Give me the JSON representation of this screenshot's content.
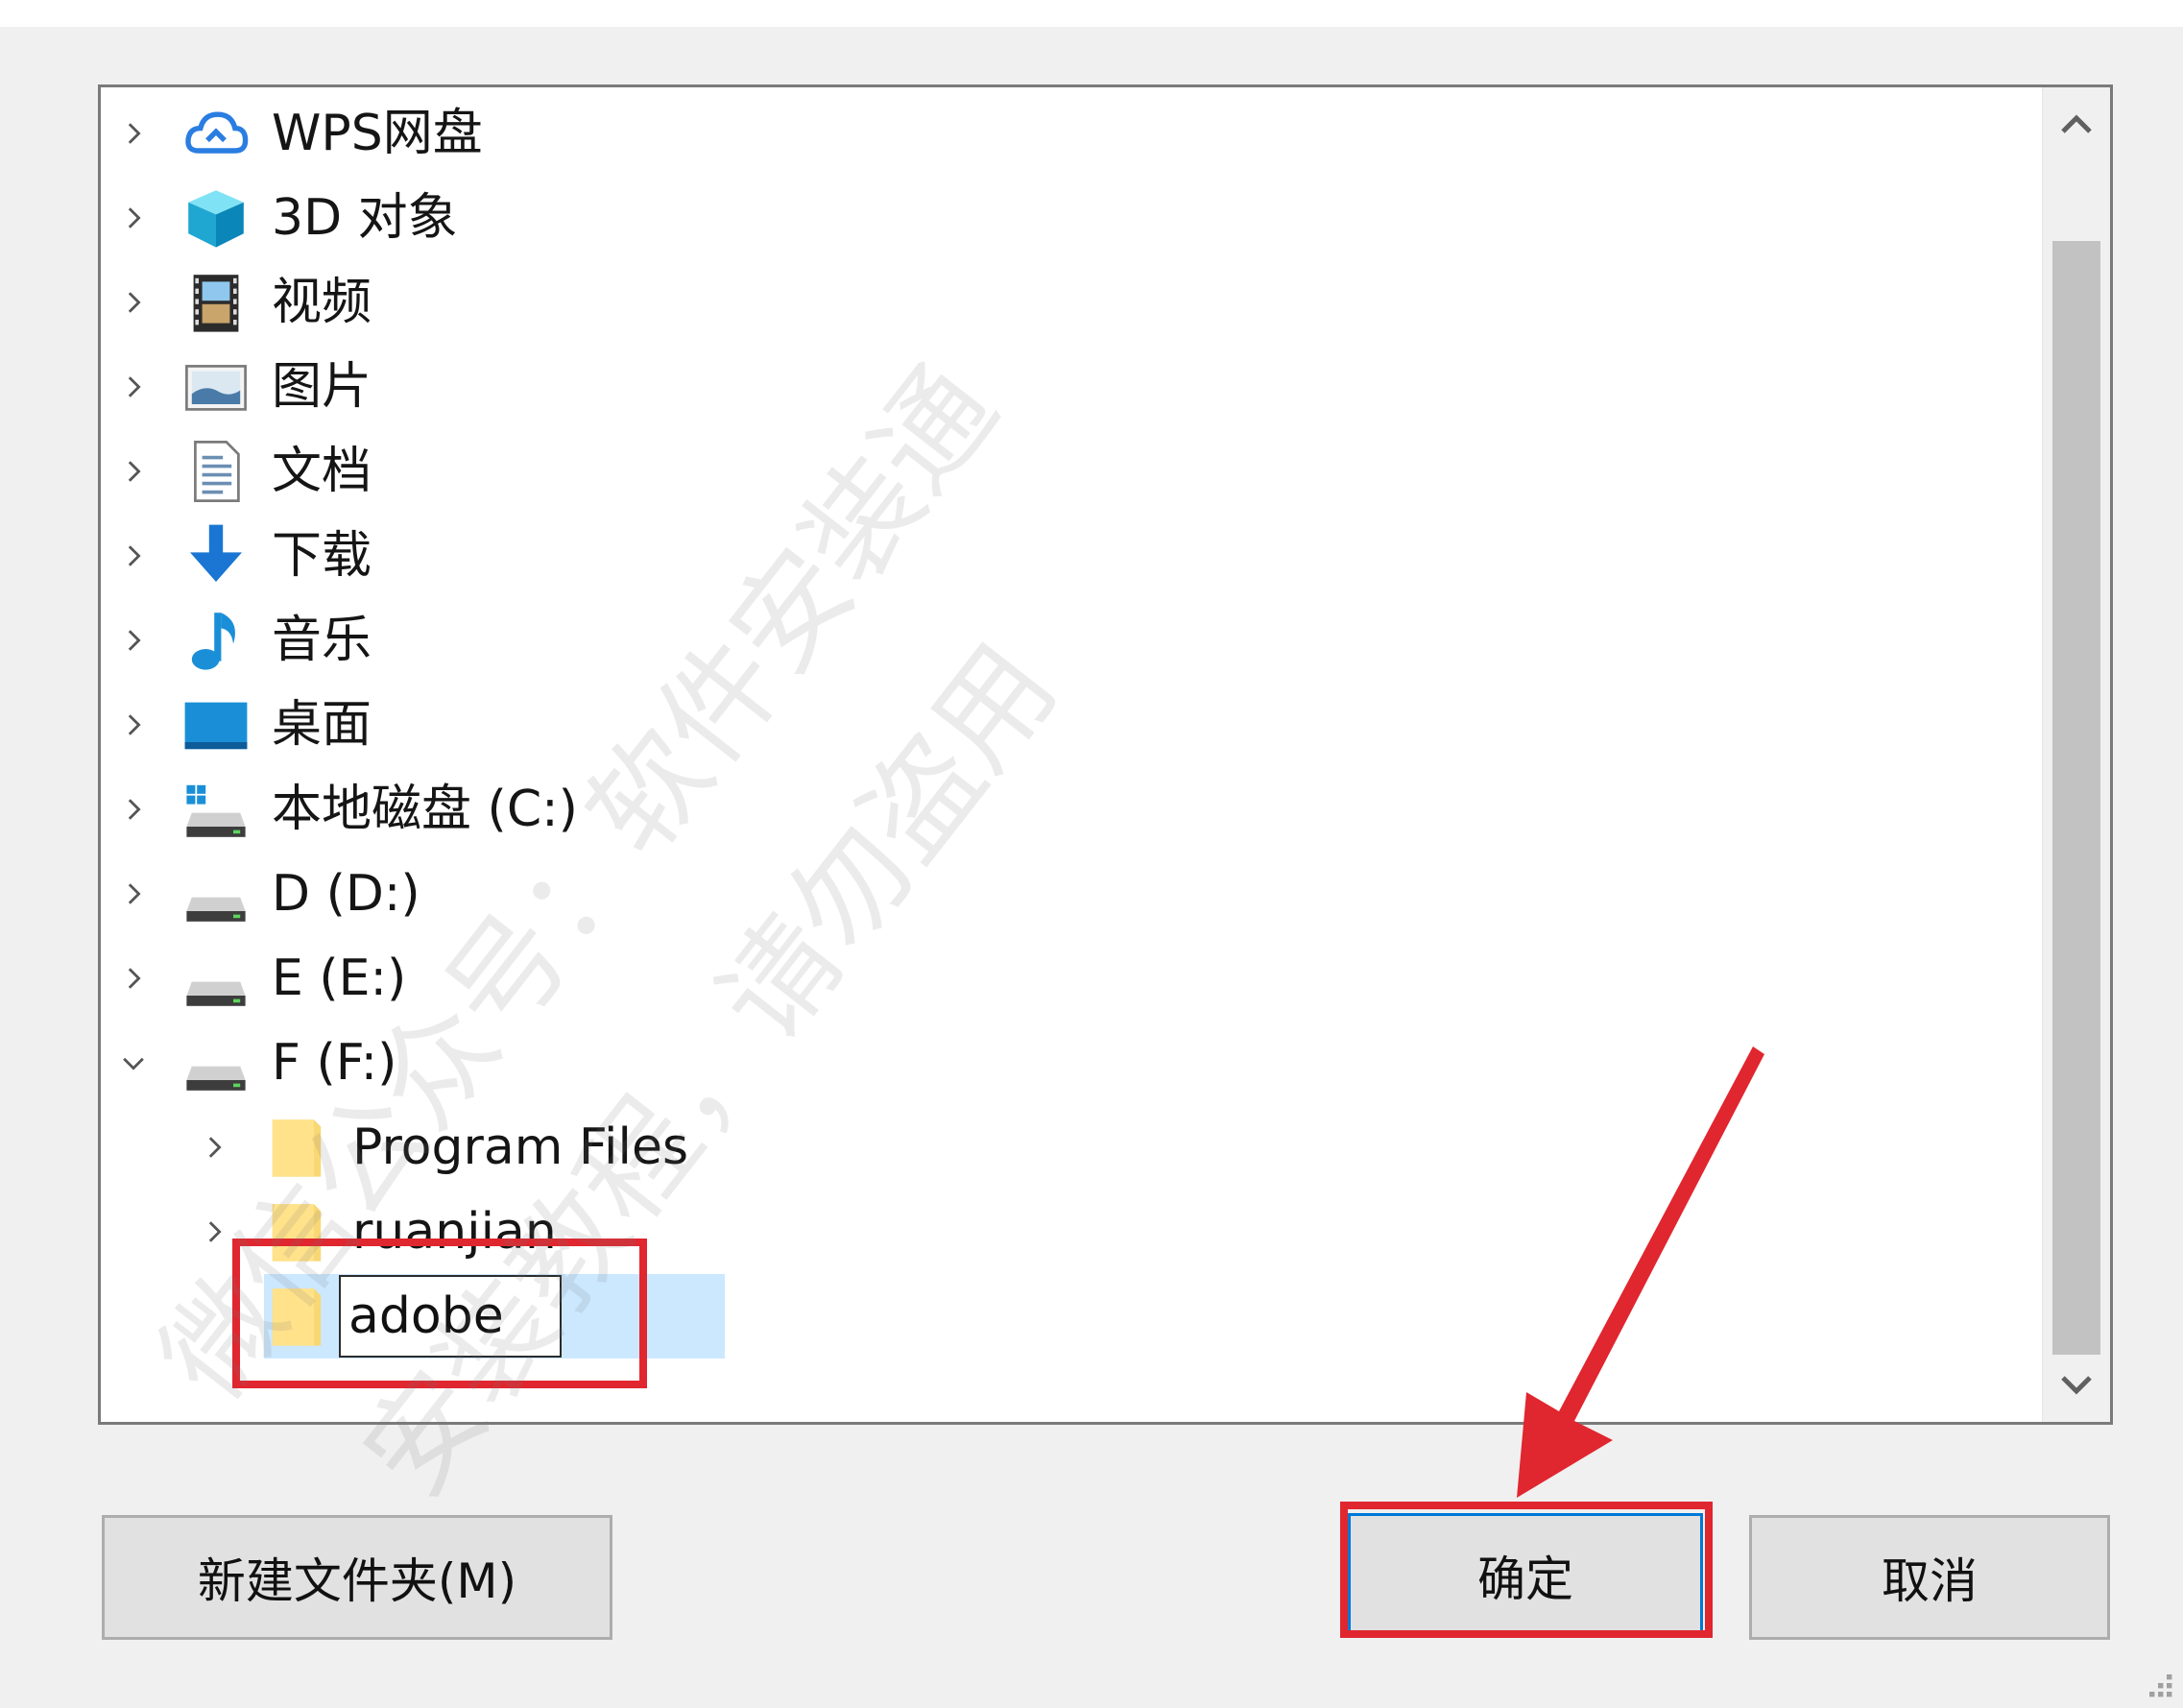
{
  "tree": {
    "items": [
      {
        "label": "WPS网盘",
        "icon": "cloud-icon",
        "expanded": false
      },
      {
        "label": "3D 对象",
        "icon": "3d-cube-icon",
        "expanded": false
      },
      {
        "label": "视频",
        "icon": "video-film-icon",
        "expanded": false
      },
      {
        "label": "图片",
        "icon": "pictures-icon",
        "expanded": false
      },
      {
        "label": "文档",
        "icon": "documents-icon",
        "expanded": false
      },
      {
        "label": "下载",
        "icon": "download-arrow-icon",
        "expanded": false
      },
      {
        "label": "音乐",
        "icon": "music-note-icon",
        "expanded": false
      },
      {
        "label": "桌面",
        "icon": "desktop-icon",
        "expanded": false
      },
      {
        "label": "本地磁盘 (C:)",
        "icon": "system-drive-icon",
        "expanded": false
      },
      {
        "label": "D (D:)",
        "icon": "drive-icon",
        "expanded": false
      },
      {
        "label": "E (E:)",
        "icon": "drive-icon",
        "expanded": false
      },
      {
        "label": "F (F:)",
        "icon": "drive-icon",
        "expanded": true
      }
    ],
    "children": [
      {
        "label": "Program Files",
        "icon": "folder-icon"
      },
      {
        "label": "ruanjian",
        "icon": "folder-icon"
      }
    ],
    "new_folder": {
      "value": "adobe",
      "icon": "folder-icon"
    }
  },
  "buttons": {
    "new_folder": "新建文件夹(M)",
    "ok": "确定",
    "cancel": "取消"
  },
  "watermark": {
    "line1": "微信公众号：软件安装通",
    "line2": "安装教程，请勿盗用"
  },
  "colors": {
    "annotation_red": "#e0262f",
    "selection_blue": "#cce8ff",
    "focus_blue": "#0078d7"
  }
}
